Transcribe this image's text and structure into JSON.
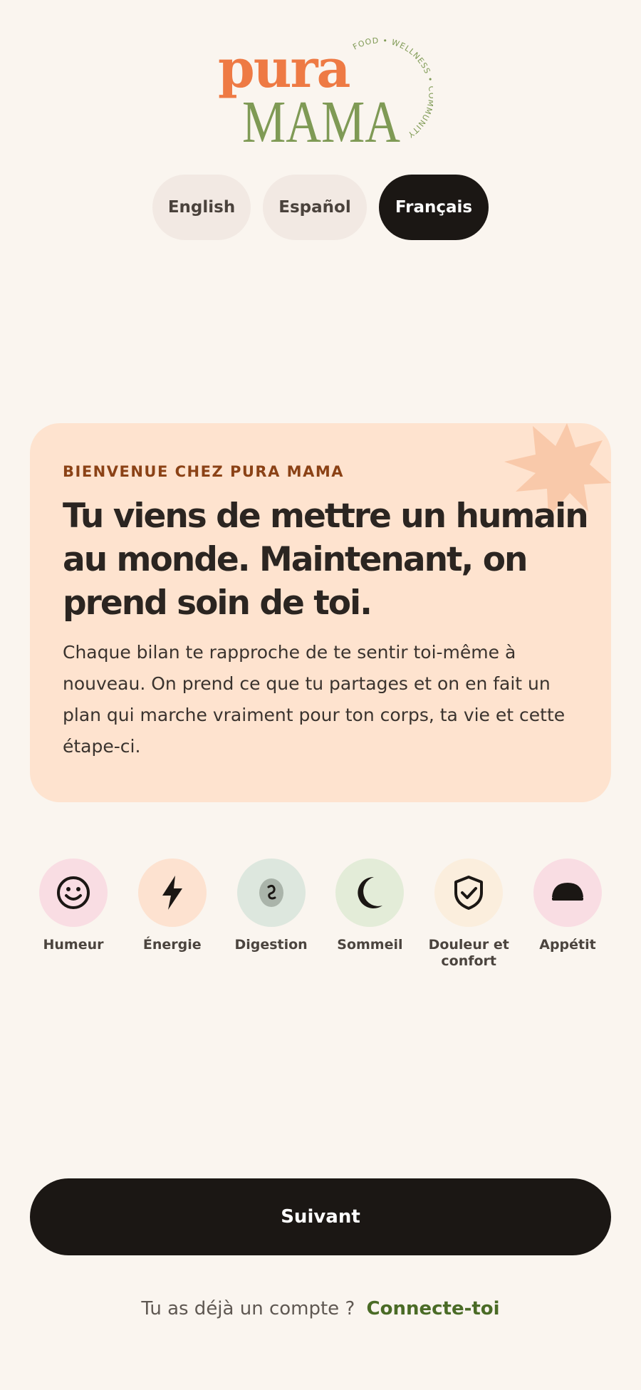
{
  "logo": {
    "top_word": "pura",
    "bottom_word": "MAMA",
    "tagline": "FOOD • WELLNESS • COMMUNITY"
  },
  "languages": [
    {
      "label": "English",
      "selected": false
    },
    {
      "label": "Español",
      "selected": false
    },
    {
      "label": "Français",
      "selected": true
    }
  ],
  "welcome": {
    "eyebrow": "BIENVENUE CHEZ PURA MAMA",
    "title": "Tu viens de mettre un humain au monde. Maintenant, on prend soin de toi.",
    "body": "Chaque bilan te rapproche de te sentir toi-même à nouveau. On prend ce que tu partages et on en fait un plan qui marche vraiment pour ton corps, ta vie et cette étape-ci."
  },
  "categories": [
    {
      "label": "Humeur",
      "icon": "smile-icon",
      "color": "#f9dde3"
    },
    {
      "label": "Énergie",
      "icon": "lightning-icon",
      "color": "#fde2d0"
    },
    {
      "label": "Digestion",
      "icon": "stomach-icon",
      "color": "#dde7de"
    },
    {
      "label": "Sommeil",
      "icon": "moon-icon",
      "color": "#e3ecd8"
    },
    {
      "label": "Douleur et confort",
      "icon": "shield-check-icon",
      "color": "#fbeedd"
    },
    {
      "label": "Appétit",
      "icon": "bowl-icon",
      "color": "#f9dde3"
    }
  ],
  "next_label": "Suivant",
  "login": {
    "prompt": "Tu as déjà un compte ?",
    "link": "Connecte-toi"
  },
  "colors": {
    "background": "#faf5ef",
    "card": "#fee3cf",
    "accent_orange": "#ee7a44",
    "accent_green": "#7f9a55",
    "link_green": "#4a6b26",
    "button_dark": "#1b1714"
  }
}
